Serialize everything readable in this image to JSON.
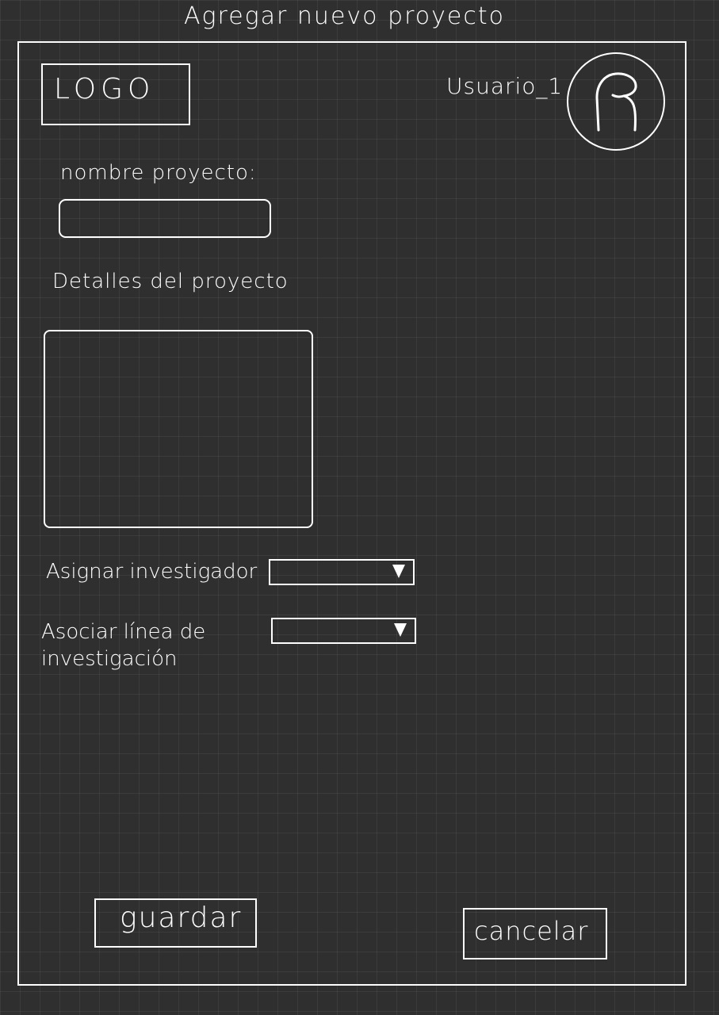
{
  "header": {
    "page_title": "Agregar nuevo proyecto",
    "logo_text": "LOGO",
    "username": "Usuario_1",
    "avatar_icon": "user-silhouette-icon"
  },
  "form": {
    "name_label": "nombre proyecto:",
    "name_value": "",
    "details_label": "Detalles del proyecto",
    "details_value": "",
    "assign_label": "Asignar investigador",
    "assign_value": "",
    "line_label": "Asociar línea de investigación",
    "line_value": "",
    "dropdown_icon": "caret-down-icon"
  },
  "actions": {
    "save_label": "guardar",
    "cancel_label": "cancelar"
  },
  "colors": {
    "background": "#2f2f2f",
    "stroke": "#ffffff",
    "grid": "#3c3c3c"
  }
}
